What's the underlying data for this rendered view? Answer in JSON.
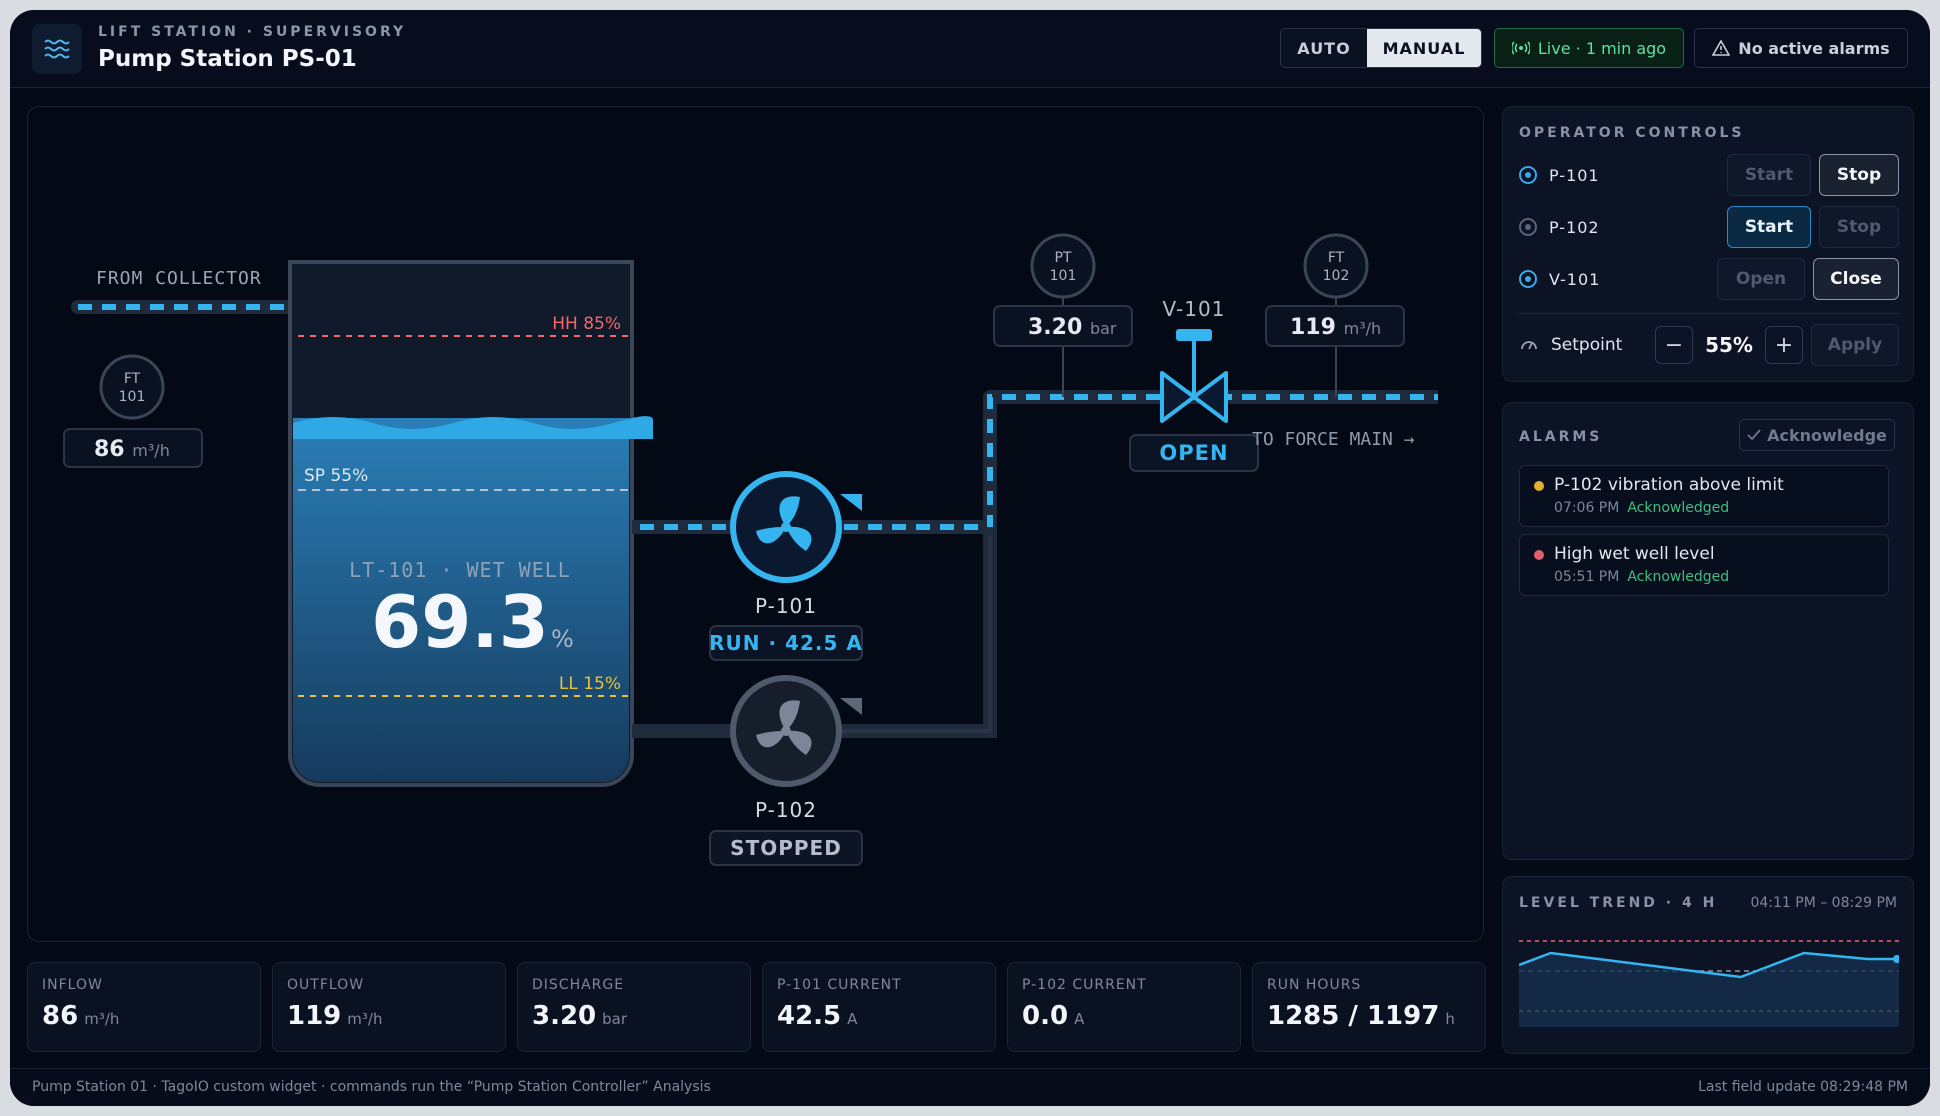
{
  "header": {
    "eyebrow": "LIFT STATION · SUPERVISORY",
    "title": "Pump Station PS-01",
    "mode_auto": "AUTO",
    "mode_manual": "MANUAL",
    "live": "Live · 1 min ago",
    "alarms_status": "No active alarms"
  },
  "diagram": {
    "from_label": "FROM COLLECTOR",
    "to_label": "TO FORCE MAIN →",
    "ft101_tag": "FT",
    "ft101_num": "101",
    "ft101_value": "86",
    "ft101_unit": "m³/h",
    "tank": {
      "hh": "HH 85%",
      "sp": "SP 55%",
      "ll": "LL 15%",
      "name": "LT-101 · WET WELL",
      "level": "69.3",
      "unit": "%",
      "level_fraction": 0.693
    },
    "p101": {
      "name": "P-101",
      "status": "RUN · 42.5 A"
    },
    "p102": {
      "name": "P-102",
      "status": "STOPPED"
    },
    "pt101_tag": "PT",
    "pt101_num": "101",
    "pt101_value": "3.20",
    "pt101_unit": "bar",
    "ft102_tag": "FT",
    "ft102_num": "102",
    "ft102_value": "119",
    "ft102_unit": "m³/h",
    "v101_name": "V-101",
    "v101_status": "OPEN"
  },
  "controls": {
    "title": "OPERATOR CONTROLS",
    "rows": [
      {
        "name": "P-101",
        "a": "Start",
        "b": "Stop"
      },
      {
        "name": "P-102",
        "a": "Start",
        "b": "Stop"
      },
      {
        "name": "V-101",
        "a": "Open",
        "b": "Close"
      }
    ],
    "setpoint_label": "Setpoint",
    "minus": "−",
    "plus": "+",
    "setpoint_value": "55%",
    "apply": "Apply"
  },
  "alarms": {
    "title": "ALARMS",
    "ack_button": "Acknowledge",
    "items": [
      {
        "msg": "P-102 vibration above limit",
        "time": "07:06 PM",
        "state": "Acknowledged",
        "color": "#e0b030"
      },
      {
        "msg": "High wet well level",
        "time": "05:51 PM",
        "state": "Acknowledged",
        "color": "#e06070"
      }
    ]
  },
  "trend": {
    "title": "LEVEL TREND · 4 H",
    "range": "04:11 PM – 08:29 PM",
    "points": [
      62,
      74,
      70,
      66,
      62,
      58,
      54,
      50,
      62,
      74,
      71,
      68,
      68
    ]
  },
  "kpis": [
    {
      "label": "INFLOW",
      "value": "86",
      "unit": "m³/h"
    },
    {
      "label": "OUTFLOW",
      "value": "119",
      "unit": "m³/h"
    },
    {
      "label": "DISCHARGE",
      "value": "3.20",
      "unit": "bar"
    },
    {
      "label": "P-101 CURRENT",
      "value": "42.5",
      "unit": "A"
    },
    {
      "label": "P-102 CURRENT",
      "value": "0.0",
      "unit": "A"
    },
    {
      "label": "RUN HOURS",
      "value": "1285 / 1197",
      "unit": "h"
    }
  ],
  "footer": {
    "left": "Pump Station 01 · TagoIO custom widget · commands run the “Pump Station Controller” Analysis",
    "right": "Last field update 08:29:48 PM"
  },
  "colors": {
    "accent": "#3aa9e8",
    "background": "#050a17",
    "ok": "#3fbf7f",
    "hh": "#f06a6a",
    "ll": "#e8c23a"
  }
}
